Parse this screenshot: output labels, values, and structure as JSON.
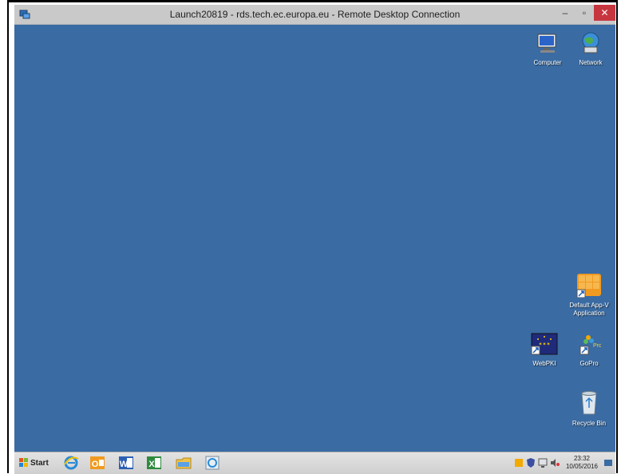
{
  "window": {
    "title": "Launch20819 - rds.tech.ec.europa.eu - Remote Desktop Connection",
    "min_label": "–",
    "max_label": "▫",
    "close_label": "✕"
  },
  "desktop_icons": [
    {
      "label": "Computer"
    },
    {
      "label": "Network"
    },
    {
      "label": "Default App-V Application"
    },
    {
      "label": "WebPKI"
    },
    {
      "label": "GoPro"
    },
    {
      "label": "Recycle Bin"
    }
  ],
  "taskbar": {
    "start_label": "Start",
    "pinned": [
      "internet-explorer",
      "outlook",
      "word",
      "excel",
      "file-explorer",
      "ie-alt"
    ],
    "clock_time": "23:32",
    "clock_date": "10/05/2016"
  },
  "colors": {
    "desktop": "#3a6ba3",
    "close_button": "#c7363e"
  }
}
